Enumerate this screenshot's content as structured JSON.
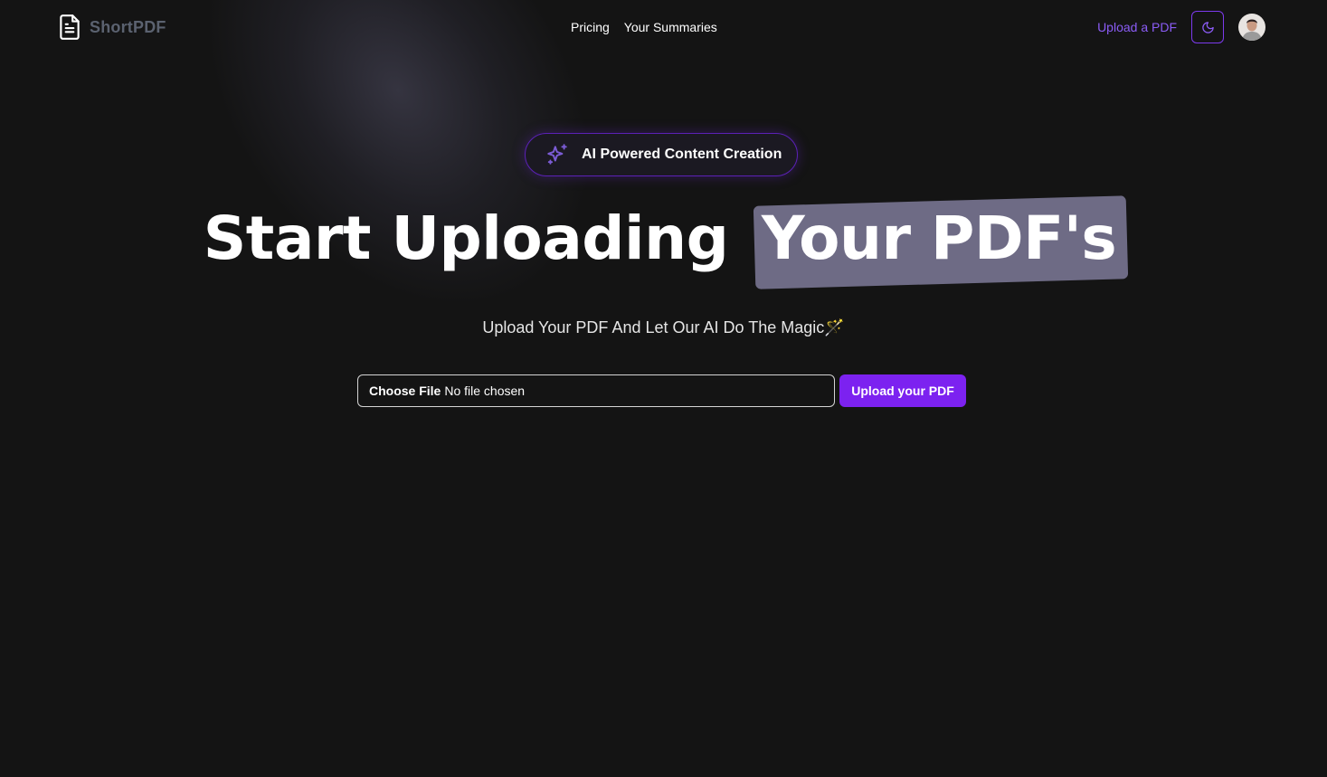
{
  "header": {
    "logo_text": "ShortPDF",
    "logo_icon": "file-text-icon",
    "nav": [
      {
        "label": "Pricing"
      },
      {
        "label": "Your Summaries"
      }
    ],
    "upload_link": "Upload a PDF",
    "theme_toggle_icon": "moon-icon",
    "avatar": "user-avatar"
  },
  "hero": {
    "badge_icon": "sparkles-icon",
    "badge_text": "AI Powered Content Creation",
    "title_start": "Start Uploading",
    "title_highlight": "Your PDF's",
    "subtitle": "Upload Your PDF And Let Our AI Do The Magic🪄"
  },
  "upload_form": {
    "choose_file_label": "Choose File",
    "file_status": "No file chosen",
    "submit_label": "Upload your PDF"
  },
  "colors": {
    "background": "#141414",
    "accent": "#7c22f0",
    "link": "#8b5cf6",
    "highlight": "#6e6b85"
  }
}
